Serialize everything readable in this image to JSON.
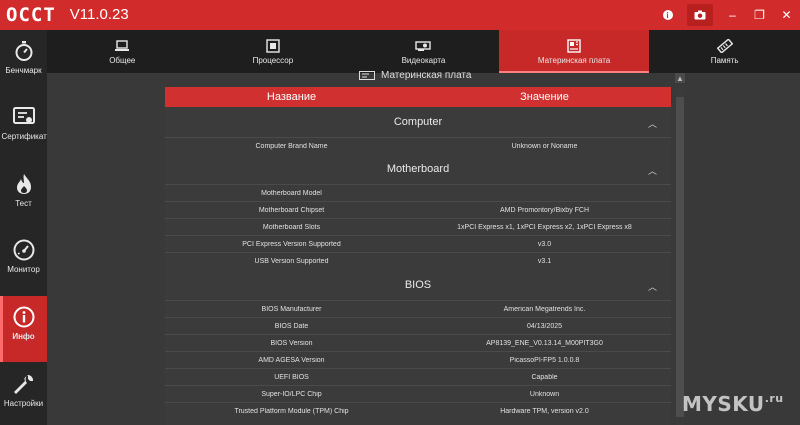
{
  "app": {
    "logo": "OCCT",
    "version": "V11.0.23"
  },
  "window_controls": {
    "info": "i",
    "camera": "📷",
    "minimize": "–",
    "restore": "❐",
    "close": "✕"
  },
  "sidebar": {
    "items": [
      {
        "label": "Бенчмарк",
        "icon": "stopwatch-icon",
        "active": false
      },
      {
        "label": "Сертификат",
        "icon": "certificate-icon",
        "active": false
      },
      {
        "label": "Тест",
        "icon": "flame-icon",
        "active": false
      },
      {
        "label": "Монитор",
        "icon": "gauge-icon",
        "active": false
      },
      {
        "label": "Инфо",
        "icon": "info-icon",
        "active": true
      },
      {
        "label": "Настройки",
        "icon": "wrench-icon",
        "active": false
      }
    ]
  },
  "tabs": [
    {
      "label": "Общее",
      "icon": "laptop-icon",
      "active": false
    },
    {
      "label": "Процессор",
      "icon": "cpu-icon",
      "active": false
    },
    {
      "label": "Видеокарта",
      "icon": "gpu-icon",
      "active": false
    },
    {
      "label": "Материнская плата",
      "icon": "motherboard-icon",
      "active": true
    },
    {
      "label": "Память",
      "icon": "memory-icon",
      "active": false
    }
  ],
  "section_title": "Материнская плата",
  "table": {
    "header_name": "Название",
    "header_value": "Значение",
    "groups": [
      {
        "title": "Computer",
        "rows": [
          {
            "name": "Computer Brand Name",
            "value": "Unknown or Noname"
          }
        ]
      },
      {
        "title": "Motherboard",
        "rows": [
          {
            "name": "Motherboard Model",
            "value": ""
          },
          {
            "name": "Motherboard Chipset",
            "value": "AMD Promontory/Bixby FCH"
          },
          {
            "name": "Motherboard Slots",
            "value": "1xPCI Express x1, 1xPCI Express x2, 1xPCI Express x8"
          },
          {
            "name": "PCI Express Version Supported",
            "value": "v3.0"
          },
          {
            "name": "USB Version Supported",
            "value": "v3.1"
          }
        ]
      },
      {
        "title": "BIOS",
        "rows": [
          {
            "name": "BIOS Manufacturer",
            "value": "American Megatrends Inc."
          },
          {
            "name": "BIOS Date",
            "value": "04/13/2025"
          },
          {
            "name": "BIOS Version",
            "value": "AP8139_ENE_V0.13.14_M00PIT3G0"
          },
          {
            "name": "AMD AGESA Version",
            "value": "PicassoPI-FP5 1.0.0.8"
          },
          {
            "name": "UEFI BIOS",
            "value": "Capable"
          },
          {
            "name": "Super-IO/LPC Chip",
            "value": "Unknown"
          },
          {
            "name": "Trusted Platform Module (TPM) Chip",
            "value": "Hardware TPM, version v2.0"
          }
        ]
      }
    ]
  },
  "collapse_glyph": "︿",
  "watermark": {
    "text": "MYSKU",
    "suffix": ".ru"
  },
  "colors": {
    "accent": "#d22b2b",
    "sidebar": "#262626",
    "tabs_bg": "#1e1e1e",
    "content_bg": "#393939"
  }
}
